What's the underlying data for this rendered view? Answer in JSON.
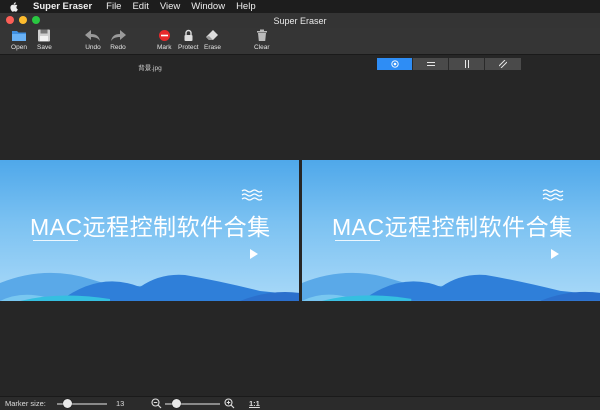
{
  "menubar": {
    "app_name": "Super Eraser",
    "items": [
      "File",
      "Edit",
      "View",
      "Window",
      "Help"
    ]
  },
  "window": {
    "title": "Super Eraser"
  },
  "toolbar": {
    "open": "Open",
    "save": "Save",
    "undo": "Undo",
    "redo": "Redo",
    "mark": "Mark",
    "protect": "Protect",
    "erase": "Erase",
    "clear": "Clear"
  },
  "file": {
    "name": "背景.jpg"
  },
  "view_modes": [
    "single-view-icon",
    "split-horizontal-icon",
    "split-vertical-icon",
    "split-diagonal-icon"
  ],
  "image": {
    "title": "MAC远程控制软件合集"
  },
  "statusbar": {
    "marker_label": "Marker size:",
    "marker_value": "13",
    "marker_fraction": 0.2,
    "zoom_fraction": 0.2,
    "zoom_reset": "1:1"
  },
  "colors": {
    "accent": "#2e8df5",
    "close": "#fc5f57",
    "minimize": "#fdbc2e",
    "maximize": "#29c841",
    "mark": "#e8292b"
  }
}
